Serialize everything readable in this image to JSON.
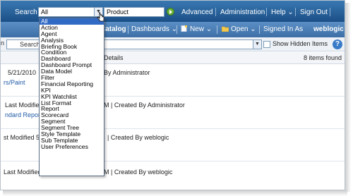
{
  "topbar": {
    "search_label": "Search",
    "scope_value": "All",
    "query_value": "Product",
    "links": [
      "Advanced",
      "Administration",
      "Help",
      "Sign Out"
    ]
  },
  "navbar": {
    "catalog": "Catalog",
    "dashboards": "Dashboards",
    "new": "New",
    "open": "Open",
    "signed_in_prefix": "Signed In As",
    "user": "weblogic"
  },
  "toolbar": {
    "filter_prefix": "n",
    "filter_value": "Search R",
    "show_hidden_label": "Show Hidden Items",
    "help": "?"
  },
  "list": {
    "details_header": "Details",
    "items_found": "8 items found",
    "rows": [
      {
        "left1": "5/21/2010",
        "left2": "rs/Paint",
        "meta": "By Administrator"
      },
      {
        "left1": "Last Modified",
        "left2": "ndard Repor",
        "meta": "M  |  Created By Administrator"
      },
      {
        "left1": "st Modified 5",
        "left2": "",
        "meta": "|  Created By weblogic"
      },
      {
        "left1": "Last Modified",
        "left2": "",
        "meta": "M  |  Created By weblogic"
      }
    ]
  },
  "dropdown": {
    "selected": "All",
    "options": [
      "All",
      "Action",
      "Agent",
      "Analysis",
      "Briefing Book",
      "Condition",
      "Dashboard",
      "Dashboard Prompt",
      "Data Model",
      "Filter",
      "Financial Reporting",
      "KPI",
      "KPI Watchlist",
      "List Format",
      "Report",
      "Scorecard",
      "Segment",
      "Segment Tree",
      "Style Template",
      "Sub Template",
      "User Preferences"
    ]
  }
}
